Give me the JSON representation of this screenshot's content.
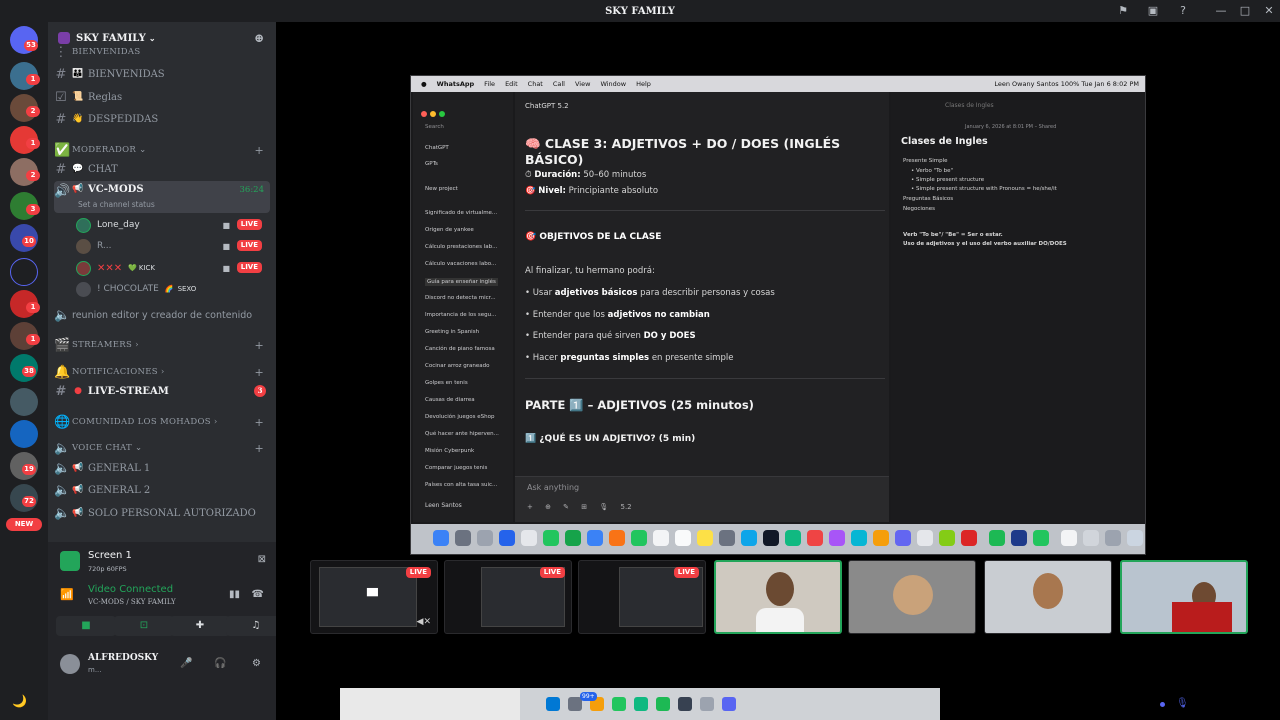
{
  "window": {
    "title": "SKY FAMILY"
  },
  "rail": {
    "badges": [
      "53",
      "1",
      "2",
      "1",
      "2",
      "3",
      "10",
      "1",
      "1",
      "38",
      "19",
      "72"
    ],
    "new_label": "NEW"
  },
  "guild": {
    "name": "SKY FAMILY"
  },
  "channels": {
    "cat_bienvenidas": "BIENVENIDAS",
    "ch_bienvenidas": "BIENVENIDAS",
    "ch_reglas": "Reglas",
    "ch_despedidas": "DESPEDIDAS",
    "cat_moderador": "MODERADOR",
    "ch_chat": "CHAT",
    "vc_mods": "VC-MODS",
    "vc_mods_timer": "36:24",
    "vc_mods_status": "Set a channel status",
    "members": [
      {
        "name": "Lone_day",
        "live": "LIVE"
      },
      {
        "name": "R...",
        "live": "LIVE"
      },
      {
        "name": "✕✕✕",
        "tag": "KICK",
        "live": "LIVE"
      },
      {
        "name": "! CHOCOLATE",
        "tag": "SEXO"
      }
    ],
    "reunion": "reunion editor y creador de contenido",
    "cat_streamers": "STREAMERS",
    "cat_notificaciones": "NOTIFICACIONES",
    "ch_livestream": "LIVE-STREAM",
    "livestream_count": "3",
    "cat_comunidad": "COMUNIDAD LOS MOHADOS",
    "cat_voice": "VOICE CHAT",
    "vc_general1": "GENERAL 1",
    "vc_general2": "GENERAL 2",
    "vc_solo": "SOLO PERSONAL AUTORIZADO"
  },
  "panel": {
    "screen_name": "Screen 1",
    "screen_sub": "720p 60FPS",
    "video_connected": "Video Connected",
    "vc_path": "VC-MODS / SKY FAMILY",
    "user_name": "ALFREDOSKY",
    "user_status": "m..."
  },
  "shared_screen": {
    "menubar": [
      "WhatsApp",
      "File",
      "Edit",
      "Chat",
      "Call",
      "View",
      "Window",
      "Help"
    ],
    "menubar_right": "Leen Owany Santos   100%   Tue Jan 6  8:02 PM",
    "sidebar": {
      "search": "Search",
      "chatgpt": "ChatGPT",
      "gpts": "GPTs",
      "new_project": "New project",
      "chats": [
        "Significado de virtualme...",
        "Origen de yankee",
        "Cálculo prestaciones lab...",
        "Cálculo vacaciones labo...",
        "Guía para enseñar inglés",
        "Discord no detecta micr...",
        "Importancia de los segu...",
        "Greeting in Spanish",
        "Canción de piano famosa",
        "Cocinar arroz graneado",
        "Golpes en tenis",
        "Causas de diarrea",
        "Devolución juegos eShop",
        "Qué hacer ante hiperven...",
        "Misión Cyberpunk",
        "Comparar juegos tenis",
        "Países con alta tasa suic..."
      ],
      "user": "Leen Santos"
    },
    "main": {
      "model": "ChatGPT 5.2",
      "h1": "🧠 CLASE 3: ADJETIVOS + DO / DOES (INGLÉS BÁSICO)",
      "duracion_label": "Duración:",
      "duracion_val": "50–60 minutos",
      "nivel_label": "Nivel:",
      "nivel_val": "Principiante absoluto",
      "objetivos": "🎯 OBJETIVOS DE LA CLASE",
      "intro": "Al finalizar, tu hermano podrá:",
      "b1a": "• Usar ",
      "b1b": "adjetivos básicos",
      "b1c": " para describir personas y cosas",
      "b2a": "• Entender que los ",
      "b2b": "adjetivos no cambian",
      "b3a": "• Entender para qué sirven ",
      "b3b": "DO y DOES",
      "b4a": "• Hacer ",
      "b4b": "preguntas simples",
      "b4c": " en presente simple",
      "h2": "PARTE 1️⃣ – ADJETIVOS (25 minutos)",
      "h3": "1️⃣ ¿QUÉ ES UN ADJETIVO? (5 min)",
      "input_placeholder": "Ask anything",
      "input_model": "5.2"
    },
    "notes": {
      "window_title": "Clases de Ingles",
      "date": "January 6, 2026 at 8:01 PM – Shared",
      "heading": "Clases de Ingles",
      "items": [
        "Presente Simple",
        "• Verbo \"To be\"",
        "• Simple present structure",
        "• Simple present structure with Pronouns = he/she/it",
        "Preguntas Básicos",
        "Negociones"
      ],
      "note1": "Verb \"To be\"/ \"Be\" = Ser o estar.",
      "note2": "Uso de adjetivos y el uso del verbo auxiliar DO/DOES"
    }
  },
  "thumbs": [
    {
      "live": "LIVE"
    },
    {
      "live": "LIVE"
    },
    {
      "live": "LIVE"
    }
  ],
  "taskbar": {
    "badge": "99+"
  }
}
